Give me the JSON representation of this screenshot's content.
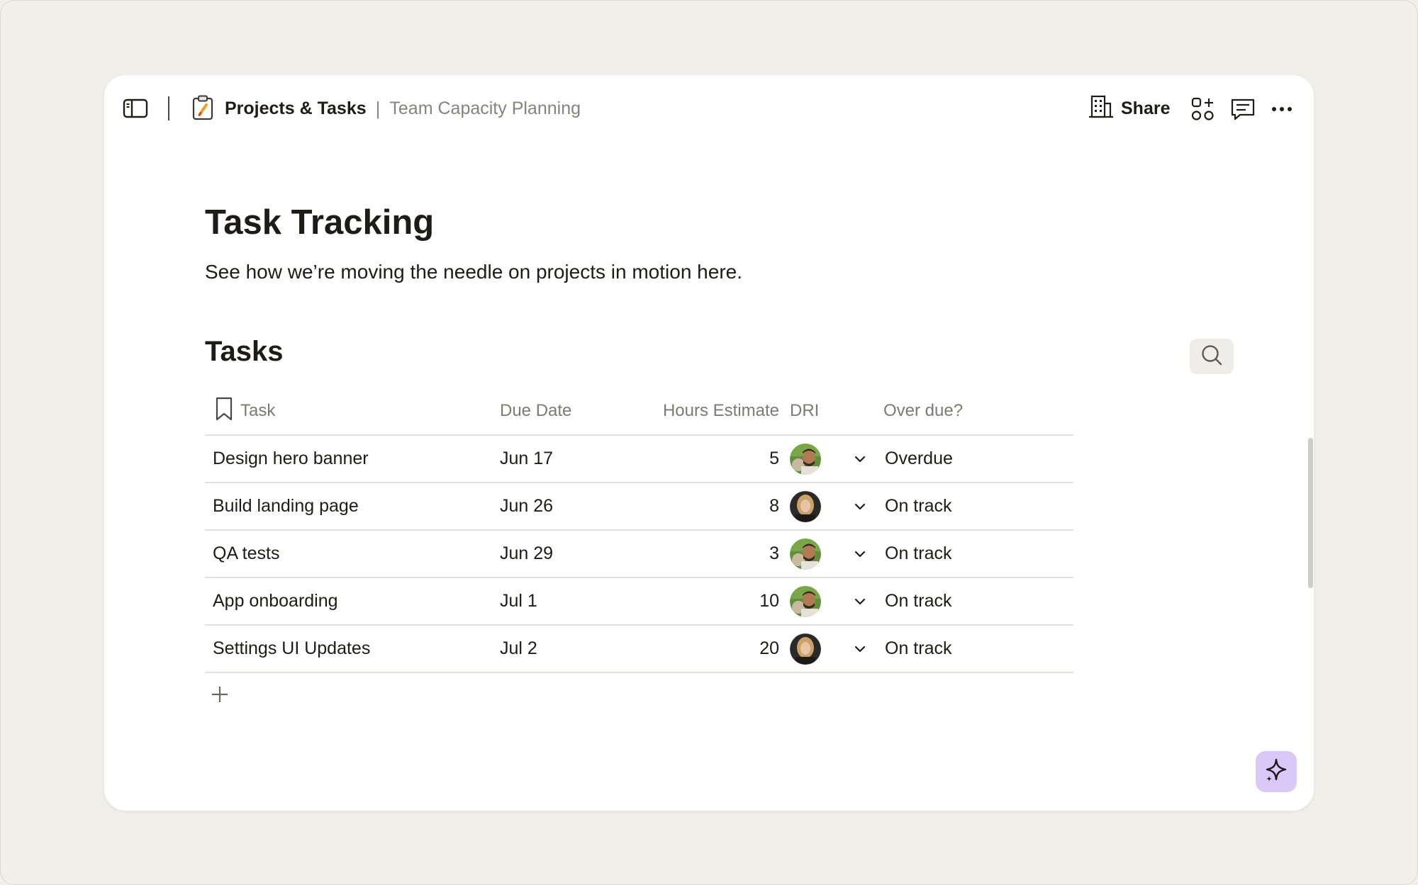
{
  "header": {
    "breadcrumb_doc": "Projects & Tasks",
    "breadcrumb_separator": "|",
    "breadcrumb_page": "Team Capacity Planning",
    "share_label": "Share",
    "icons": {
      "sidebar_toggle": "sidebar-toggle-icon",
      "doc": "clipboard-icon",
      "share": "building-icon",
      "apps": "apps-add-icon",
      "comment": "comment-icon",
      "more": "more-horizontal-icon"
    }
  },
  "page": {
    "title": "Task Tracking",
    "description": "See how we’re moving the needle on projects in motion here."
  },
  "tasks_section": {
    "title": "Tasks",
    "search_icon": "search-icon",
    "columns": {
      "task": "Task",
      "due_date": "Due Date",
      "hours": "Hours Estimate",
      "dri": "DRI",
      "overdue": "Over due?"
    },
    "rows": [
      {
        "task": "Design hero banner",
        "due": "Jun 17",
        "hours": "5",
        "dri_avatar": "man",
        "status": "Overdue"
      },
      {
        "task": "Build landing page",
        "due": "Jun 26",
        "hours": "8",
        "dri_avatar": "woman",
        "status": "On track"
      },
      {
        "task": "QA tests",
        "due": "Jun 29",
        "hours": "3",
        "dri_avatar": "man",
        "status": "On track"
      },
      {
        "task": "App onboarding",
        "due": "Jul 1",
        "hours": "10",
        "dri_avatar": "man",
        "status": "On track"
      },
      {
        "task": "Settings UI Updates",
        "due": "Jul 2",
        "hours": "20",
        "dri_avatar": "woman",
        "status": "On track"
      }
    ],
    "add_row_icon": "plus-icon"
  },
  "ai_button_icon": "sparkle-icon",
  "colors": {
    "background": "#f1efe9",
    "card": "#ffffff",
    "ai_button": "#d9c8f8",
    "search_button": "#efede8",
    "muted_text": "#86837f"
  }
}
